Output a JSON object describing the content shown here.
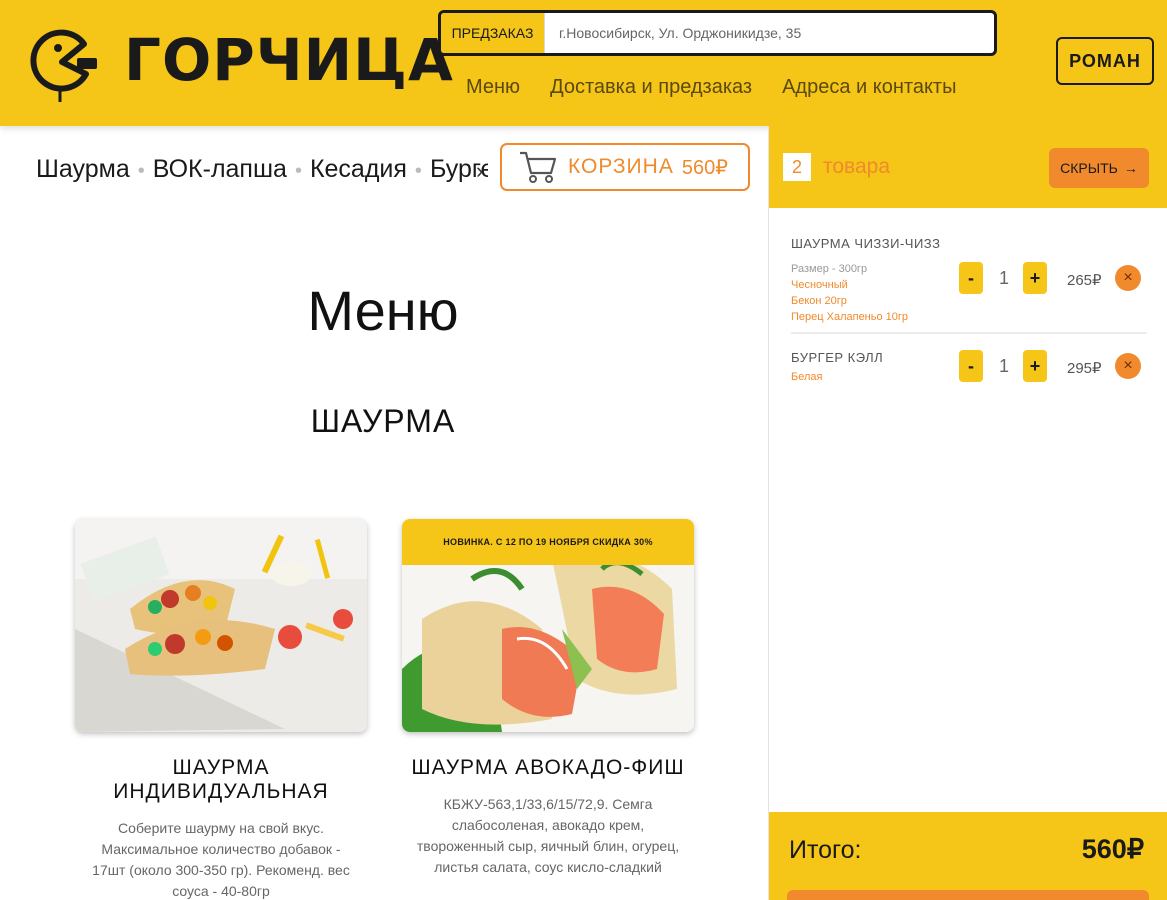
{
  "brand": {
    "name": "ГОРЧИЦА"
  },
  "header": {
    "preorder_label": "ПРЕДЗАКАЗ",
    "address": "г.Новосибирск, Ул. Орджоникидзе, 35",
    "nav": [
      "Меню",
      "Доставка и предзаказ",
      "Адреса и контакты"
    ],
    "user": "РОМАН"
  },
  "categories": [
    "Шаурма",
    "ВОК-лапша",
    "Кесадия",
    "Бургеры"
  ],
  "cart_button": {
    "label": "КОРЗИНА",
    "sum": "560₽"
  },
  "main": {
    "title": "Меню",
    "section": "ШАУРМА"
  },
  "products": [
    {
      "name": "ШАУРМА ИНДИВИДУАЛЬНАЯ",
      "description": "Соберите шаурму на свой вкус. Максимальное количество добавок - 17шт (около 300-350 гр). Рекоменд. вес соуса - 40-80гр"
    },
    {
      "name": "ШАУРМА АВОКАДО-ФИШ",
      "badge": "НОВИНКА. С 12 ПО 19 НОЯБРЯ СКИДКА 30%",
      "description": "КБЖУ-563,1/33,6/15/72,9. Семга слабосоленая, авокадо крем, твороженный сыр, яичный блин, огурец, листья салата, соус кисло-сладкий"
    }
  ],
  "sidebar": {
    "count": "2",
    "count_label": "товара",
    "hide_label": "СКРЫТЬ",
    "items": [
      {
        "name": "ШАУРМА ЧИЗЗИ-ЧИЗЗ",
        "options": [
          "Размер - 300гр"
        ],
        "extras": [
          "Чесночный",
          "Бекон 20гр",
          "Перец Халапеньо 10гр"
        ],
        "qty": "1",
        "price": "265₽"
      },
      {
        "name": "БУРГЕР КЭЛЛ",
        "options": [],
        "extras": [
          "Белая"
        ],
        "qty": "1",
        "price": "295₽"
      }
    ],
    "total_label": "Итого:",
    "total": "560₽"
  },
  "colors": {
    "yellow": "#f5c518",
    "orange": "#f08a2c",
    "text": "#1a1a1a"
  }
}
